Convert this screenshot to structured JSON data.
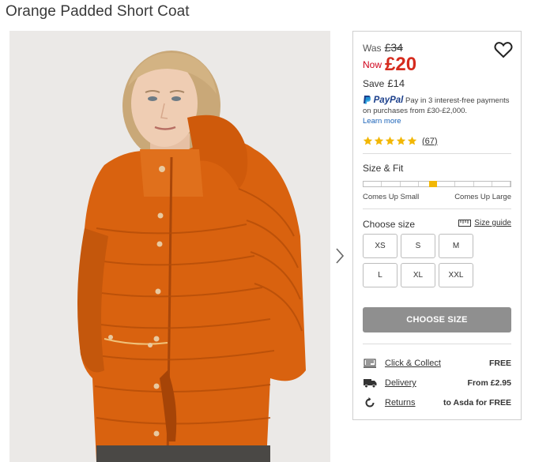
{
  "product": {
    "title": "Orange Padded Short Coat"
  },
  "gallery": {
    "next_icon": "chevron-right-icon"
  },
  "price": {
    "was_label": "Was",
    "was_value": "£34",
    "now_label": "Now",
    "now_value": "£20",
    "save_label": "Save",
    "save_value": "£14"
  },
  "wishlist": {
    "icon": "heart-icon"
  },
  "paypal": {
    "logo_pay": "PayPal",
    "message": "Pay in 3 interest-free payments on purchases from £30-£2,000.",
    "learn_more": "Learn more"
  },
  "rating": {
    "stars": 5,
    "count_label": "(67)"
  },
  "fit": {
    "label": "Size & Fit",
    "position": 0.47,
    "left_label": "Comes Up Small",
    "right_label": "Comes Up Large"
  },
  "size_picker": {
    "label": "Choose size",
    "guide_label": "Size guide",
    "sizes": [
      "XS",
      "S",
      "M",
      "L",
      "XL",
      "XXL"
    ]
  },
  "cta": {
    "label": "CHOOSE SIZE"
  },
  "delivery": [
    {
      "icon": "click-collect-icon",
      "label": "Click & Collect",
      "value": "FREE"
    },
    {
      "icon": "delivery-truck-icon",
      "label": "Delivery",
      "value": "From £2.95"
    },
    {
      "icon": "returns-icon",
      "label": "Returns",
      "value": "to Asda for FREE"
    }
  ],
  "colors": {
    "sale_red": "#d52b1e",
    "star_gold": "#f2b705",
    "cta_grey": "#8f8f8f",
    "coat_orange": "#d9620f"
  }
}
